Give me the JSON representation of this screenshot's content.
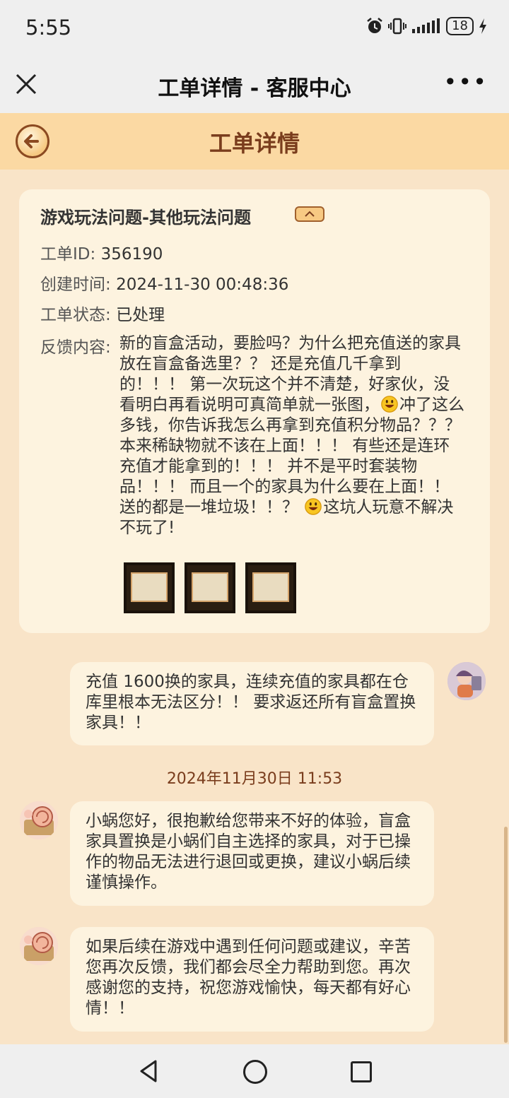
{
  "status_bar": {
    "time": "5:55",
    "battery": "18"
  },
  "titlebar": {
    "title": "工单详情 - 客服中心",
    "more": "•••"
  },
  "header": {
    "title": "工单详情"
  },
  "ticket": {
    "title": "游戏玩法问题-其他玩法问题",
    "id_label": "工单ID:",
    "id_value": "356190",
    "created_label": "创建时间:",
    "created_value": "2024-11-30 00:48:36",
    "status_label": "工单状态:",
    "status_value": "已处理",
    "feedback_label": "反馈内容:",
    "feedback_text_1": "新的盲盒活动，要脸吗？为什么把充值送的家具放在盲盒备选里？？ 还是充值几千拿到的！！！ 第一次玩这个并不清楚，好家伙，没看明白再看说明可真简单就一张图，",
    "feedback_text_2": "冲了这么多钱，你告诉我怎么再拿到充值积分物品？？？ 本来稀缺物就不该在上面！！！ 有些还是连环充值才能拿到的！！！ 并不是平时套装物品！！！ 而且一个的家具为什么要在上面！！ 送的都是一堆垃圾！！？",
    "feedback_text_3": "这坑人玩意不解决不玩了!"
  },
  "messages": {
    "user_1": "充值 1600换的家具，连续充值的家具都在仓库里根本无法区分！！ 要求返还所有盲盒置换家具！！",
    "timestamp": "2024年11月30日 11:53",
    "cs_1": "小蜗您好，很抱歉给您带来不好的体验，盲盒家具置换是小蜗们自主选择的家具，对于已操作的物品无法进行退回或更换，建议小蜗后续谨慎操作。",
    "cs_2": "如果后续在游戏中遇到任何问题或建议，辛苦您再次反馈，我们都会尽全力帮助到您。再次感谢您的支持，祝您游戏愉快，每天都有好心情！！"
  }
}
